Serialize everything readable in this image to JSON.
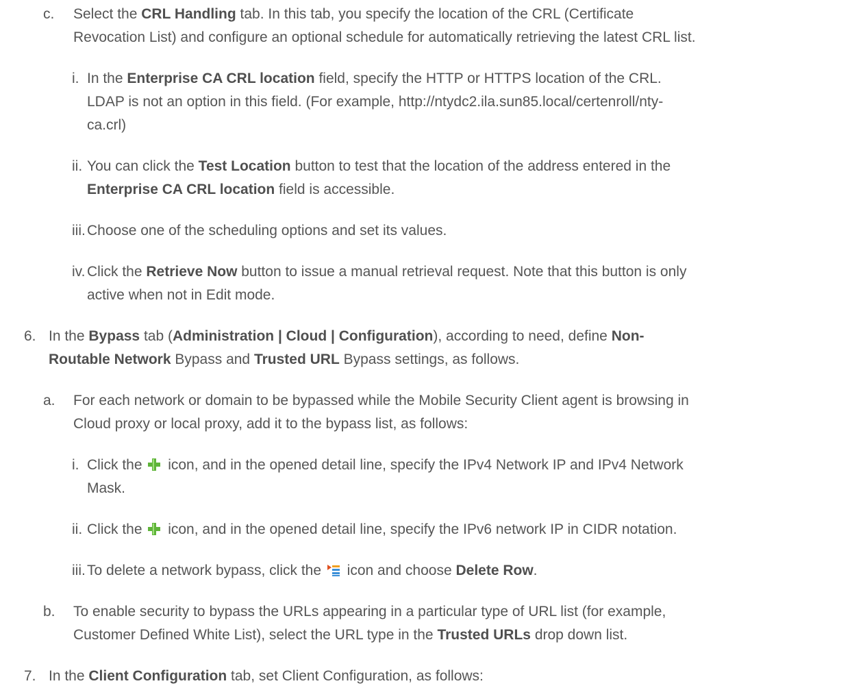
{
  "items": {
    "c": {
      "marker": "c.",
      "l1": [
        "Select the ",
        "CRL Handling",
        " tab. In this tab, you specify the location of the CRL (Certificate"
      ],
      "l2": "Revocation List) and configure an optional schedule for automatically retrieving the latest CRL list."
    },
    "c_i": {
      "marker": "i.",
      "l1": [
        "In the ",
        "Enterprise CA CRL location",
        " field, specify the HTTP or HTTPS location of the CRL."
      ],
      "l2": "LDAP is not an option in this field. (For example, http://ntydc2.ila.sun85.local/certenroll/nty-",
      "l3": "ca.crl)"
    },
    "c_ii": {
      "marker": "ii.",
      "l1": [
        "You can click the ",
        "Test Location",
        " button to test that the location of the address entered in the"
      ],
      "l2": [
        "Enterprise CA CRL location",
        " field is accessible."
      ]
    },
    "c_iii": {
      "marker": "iii.",
      "l1": "Choose one of the scheduling options and set its values."
    },
    "c_iv": {
      "marker": "iv.",
      "l1": [
        "Click the ",
        "Retrieve Now",
        " button to issue a manual retrieval request. Note that this button is only"
      ],
      "l2": "active when not in Edit mode."
    },
    "s6": {
      "marker": "6.",
      "l1": [
        "In the ",
        "Bypass",
        " tab (",
        "Administration | Cloud | Configuration",
        "), according to need, define ",
        "Non-"
      ],
      "l2": [
        "Routable Network",
        " Bypass and ",
        "Trusted URL",
        " Bypass settings, as follows."
      ]
    },
    "s6a": {
      "marker": "a.",
      "l1": "For each network or domain to be bypassed while the Mobile Security Client agent is browsing in",
      "l2": "Cloud proxy or local proxy, add it to the bypass list, as follows:"
    },
    "s6a_i": {
      "marker": "i.",
      "l1": [
        "Click the ",
        " icon, and in the opened detail line, specify the IPv4 Network IP and IPv4 Network"
      ],
      "l2": "Mask."
    },
    "s6a_ii": {
      "marker": "ii.",
      "l1": [
        "Click the ",
        " icon, and in the opened detail line, specify the IPv6 network IP in CIDR notation."
      ]
    },
    "s6a_iii": {
      "marker": "iii.",
      "l1": [
        "To delete a network bypass, click the ",
        " icon and choose ",
        "Delete Row",
        "."
      ]
    },
    "s6b": {
      "marker": "b.",
      "l1": "To enable security to bypass the URLs appearing in a particular type of URL list (for example,",
      "l2": [
        "Customer Defined White List), select the URL type in the ",
        "Trusted URLs",
        " drop down list."
      ]
    },
    "s7": {
      "marker": "7.",
      "l1": [
        "In the ",
        "Client Configuration",
        " tab, set Client Configuration, as follows:"
      ]
    }
  },
  "icons": {
    "add": "plus-icon",
    "row_menu": "row-menu-icon",
    "add_color": "#5fb43a",
    "menu_color": "#f0a020"
  }
}
